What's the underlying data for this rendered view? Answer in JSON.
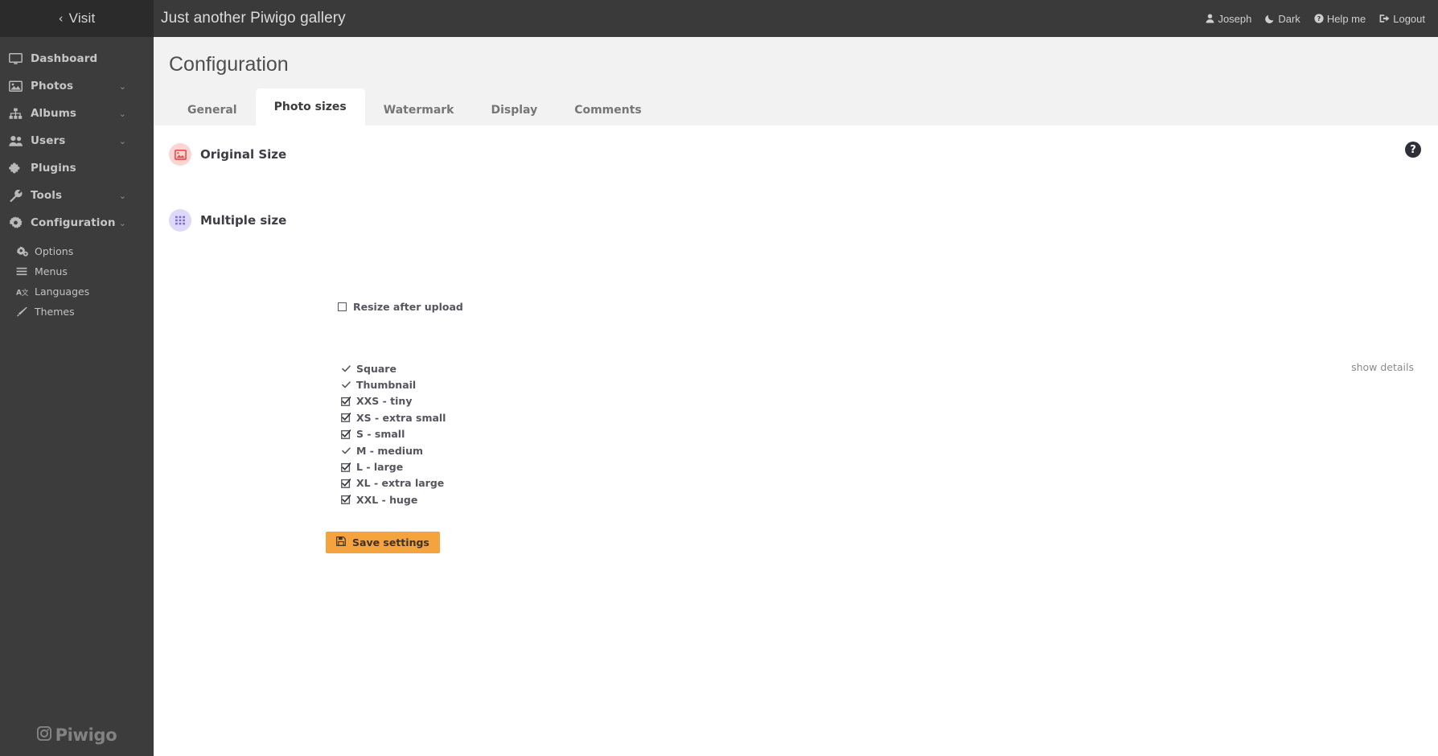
{
  "topbar": {
    "visit_label": "Visit",
    "visit_chevron": "‹",
    "gallery_title": "Just another Piwigo gallery",
    "user_menu": [
      {
        "label": "Joseph",
        "icon": "user-icon"
      },
      {
        "label": "Dark",
        "icon": "moon-icon"
      },
      {
        "label": "Help me",
        "icon": "question-circle-icon"
      },
      {
        "label": "Logout",
        "icon": "logout-icon"
      }
    ]
  },
  "sidebar": {
    "items": [
      {
        "label": "Dashboard",
        "icon": "monitor-icon",
        "caret": false
      },
      {
        "label": "Photos",
        "icon": "photo-icon",
        "caret": true
      },
      {
        "label": "Albums",
        "icon": "sitemap-icon",
        "caret": true
      },
      {
        "label": "Users",
        "icon": "users-icon",
        "caret": true
      },
      {
        "label": "Plugins",
        "icon": "puzzle-icon",
        "caret": false
      },
      {
        "label": "Tools",
        "icon": "wrench-icon",
        "caret": true
      },
      {
        "label": "Configuration",
        "icon": "gear-icon",
        "caret": true
      }
    ],
    "sub_items": [
      {
        "label": "Options",
        "icon": "gears-icon"
      },
      {
        "label": "Menus",
        "icon": "bars-icon"
      },
      {
        "label": "Languages",
        "icon": "language-icon"
      },
      {
        "label": "Themes",
        "icon": "brush-icon"
      }
    ],
    "caret_glyph": "⌄",
    "logo_text": "Piwigo"
  },
  "page": {
    "title": "Configuration",
    "tabs": [
      {
        "label": "General",
        "active": false
      },
      {
        "label": "Photo sizes",
        "active": true
      },
      {
        "label": "Watermark",
        "active": false
      },
      {
        "label": "Display",
        "active": false
      },
      {
        "label": "Comments",
        "active": false
      }
    ],
    "help_badge": "?"
  },
  "original_size": {
    "title": "Original Size",
    "icon": "image-icon",
    "badge_color": "#fbd4d4",
    "resize_after_upload": {
      "label": "Resize after upload",
      "checked": false
    }
  },
  "multiple_size": {
    "title": "Multiple size",
    "icon": "grid-icon",
    "badge_color": "#ded9fb",
    "show_details_label": "show details",
    "sizes": [
      {
        "label": "Square",
        "mark": "check",
        "locked": true
      },
      {
        "label": "Thumbnail",
        "mark": "check",
        "locked": true
      },
      {
        "label": "XXS - tiny",
        "mark": "checkbox",
        "locked": false
      },
      {
        "label": "XS - extra small",
        "mark": "checkbox",
        "locked": false
      },
      {
        "label": "S - small",
        "mark": "checkbox",
        "locked": false
      },
      {
        "label": "M - medium",
        "mark": "check",
        "locked": true
      },
      {
        "label": "L - large",
        "mark": "checkbox",
        "locked": false
      },
      {
        "label": "XL - extra large",
        "mark": "checkbox",
        "locked": false
      },
      {
        "label": "XXL - huge",
        "mark": "checkbox",
        "locked": false
      }
    ]
  },
  "save_button": {
    "label": "Save settings",
    "icon": "save-icon",
    "color": "#f5a33e"
  }
}
